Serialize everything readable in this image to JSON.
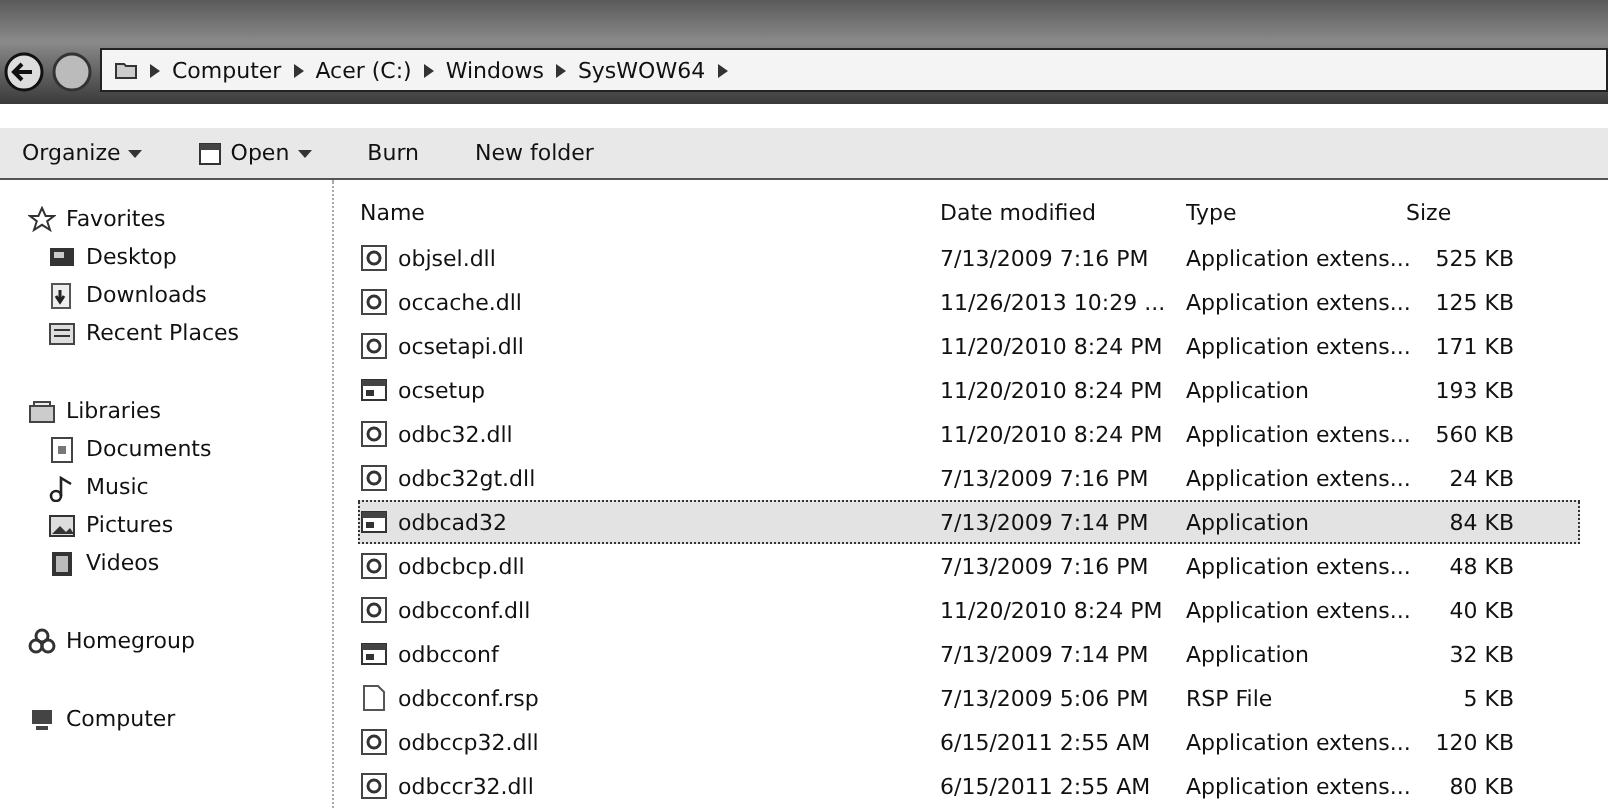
{
  "address": {
    "crumbs": [
      "Computer",
      "Acer (C:)",
      "Windows",
      "SysWOW64"
    ]
  },
  "toolbar": [
    {
      "label": "Organize",
      "menu": true,
      "kind": "plain"
    },
    {
      "label": "Open",
      "menu": true,
      "kind": "open"
    },
    {
      "label": "Burn",
      "menu": false,
      "kind": "plain"
    },
    {
      "label": "New folder",
      "menu": false,
      "kind": "plain"
    }
  ],
  "sidebar": [
    {
      "label": "Favorites",
      "kind": "star",
      "children": [
        {
          "label": "Desktop",
          "kind": "desktop"
        },
        {
          "label": "Downloads",
          "kind": "download"
        },
        {
          "label": "Recent Places",
          "kind": "recent"
        }
      ]
    },
    {
      "label": "Libraries",
      "kind": "library",
      "children": [
        {
          "label": "Documents",
          "kind": "document"
        },
        {
          "label": "Music",
          "kind": "music"
        },
        {
          "label": "Pictures",
          "kind": "picture"
        },
        {
          "label": "Videos",
          "kind": "video"
        }
      ]
    },
    {
      "label": "Homegroup",
      "kind": "homegroup"
    },
    {
      "label": "Computer",
      "kind": "computer"
    }
  ],
  "table": {
    "columns": [
      "Name",
      "Date modified",
      "Type",
      "Size"
    ],
    "rows": [
      {
        "kind": "dll",
        "selected": false,
        "cells": [
          "objsel.dll",
          "7/13/2009 7:16 PM",
          "Application extens...",
          "525 KB"
        ]
      },
      {
        "kind": "dll",
        "selected": false,
        "cells": [
          "occache.dll",
          "11/26/2013 10:29 ...",
          "Application extens...",
          "125 KB"
        ]
      },
      {
        "kind": "dll",
        "selected": false,
        "cells": [
          "ocsetapi.dll",
          "11/20/2010 8:24 PM",
          "Application extens...",
          "171 KB"
        ]
      },
      {
        "kind": "app",
        "selected": false,
        "cells": [
          "ocsetup",
          "11/20/2010 8:24 PM",
          "Application",
          "193 KB"
        ]
      },
      {
        "kind": "dll",
        "selected": false,
        "cells": [
          "odbc32.dll",
          "11/20/2010 8:24 PM",
          "Application extens...",
          "560 KB"
        ]
      },
      {
        "kind": "dll",
        "selected": false,
        "cells": [
          "odbc32gt.dll",
          "7/13/2009 7:16 PM",
          "Application extens...",
          "24 KB"
        ]
      },
      {
        "kind": "app",
        "selected": true,
        "cells": [
          "odbcad32",
          "7/13/2009 7:14 PM",
          "Application",
          "84 KB"
        ]
      },
      {
        "kind": "dll",
        "selected": false,
        "cells": [
          "odbcbcp.dll",
          "7/13/2009 7:16 PM",
          "Application extens...",
          "48 KB"
        ]
      },
      {
        "kind": "dll",
        "selected": false,
        "cells": [
          "odbcconf.dll",
          "11/20/2010 8:24 PM",
          "Application extens...",
          "40 KB"
        ]
      },
      {
        "kind": "app",
        "selected": false,
        "cells": [
          "odbcconf",
          "7/13/2009 7:14 PM",
          "Application",
          "32 KB"
        ]
      },
      {
        "kind": "file",
        "selected": false,
        "cells": [
          "odbcconf.rsp",
          "7/13/2009 5:06 PM",
          "RSP File",
          "5 KB"
        ]
      },
      {
        "kind": "dll",
        "selected": false,
        "cells": [
          "odbccp32.dll",
          "6/15/2011 2:55 AM",
          "Application extens...",
          "120 KB"
        ]
      },
      {
        "kind": "dll",
        "selected": false,
        "cells": [
          "odbccr32.dll",
          "6/15/2011 2:55 AM",
          "Application extens...",
          "80 KB"
        ]
      }
    ]
  }
}
